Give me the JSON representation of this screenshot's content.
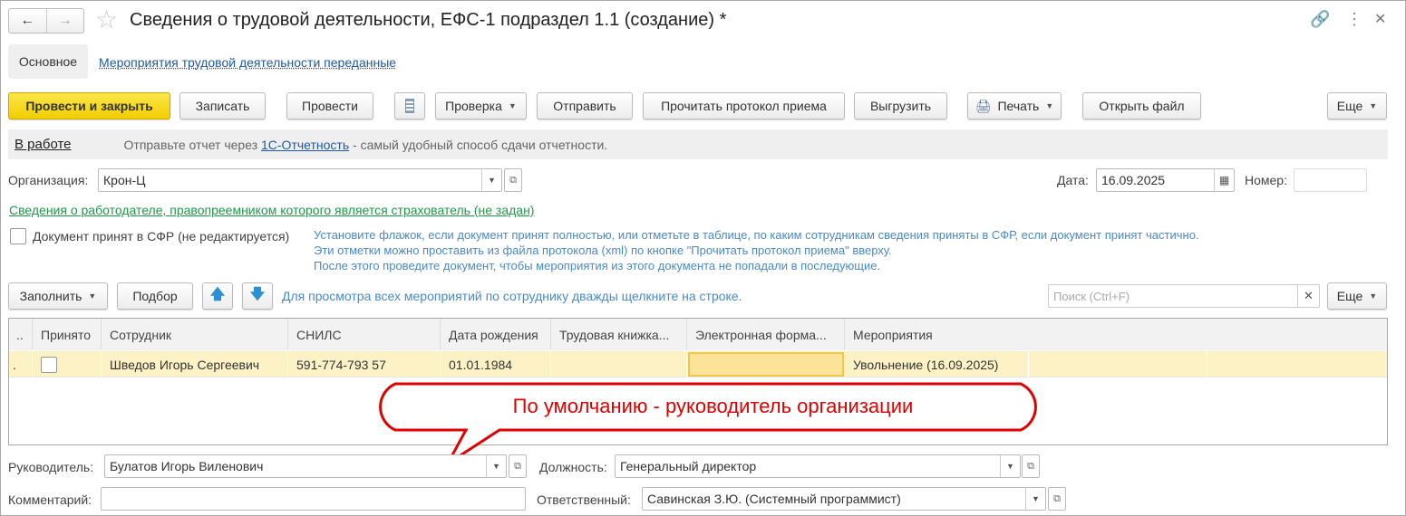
{
  "title": "Сведения о трудовой деятельности, ЕФС-1 подраздел 1.1 (создание) *",
  "tabs": [
    "Основное",
    "Мероприятия трудовой деятельности переданные"
  ],
  "toolbar": {
    "post_close": "Провести и закрыть",
    "save": "Записать",
    "post": "Провести",
    "check": "Проверка",
    "send": "Отправить",
    "read_protocol": "Прочитать протокол приема",
    "export": "Выгрузить",
    "print": "Печать",
    "open_file": "Открыть файл",
    "more": "Еще"
  },
  "status": {
    "state": "В работе",
    "text_before": "Отправьте отчет через ",
    "link": "1С-Отчетность",
    "text_after": " - самый удобный способ сдачи отчетности."
  },
  "org": {
    "label": "Организация:",
    "value": "Крон-Ц"
  },
  "date": {
    "label": "Дата:",
    "value": "16.09.2025"
  },
  "number": {
    "label": "Номер:",
    "value": ""
  },
  "employer_link": "Сведения о работодателе, правопреемником которого является страхователь (не задан)",
  "accepted": {
    "label": "Документ принят в СФР (не редактируется)",
    "checked": false
  },
  "hint": [
    "Установите флажок, если документ принят полностью, или отметьте в таблице, по каким сотрудникам сведения приняты в СФР, если документ принят частично.",
    "Эти отметки можно проставить из файла протокола (xml) по кнопке \"Прочитать протокол приема\" вверху.",
    "После этого проведите документ, чтобы мероприятия из этого документа не попадали в последующие."
  ],
  "table_toolbar": {
    "fill": "Заполнить",
    "select": "Подбор",
    "hint": "Для просмотра всех мероприятий по сотруднику дважды щелкните на строке.",
    "search_placeholder": "Поиск (Ctrl+F)",
    "more": "Еще"
  },
  "columns": [
    "..",
    "Принято",
    "Сотрудник",
    "СНИЛС",
    "Дата рождения",
    "Трудовая книжка...",
    "Электронная форма...",
    "Мероприятия"
  ],
  "rows": [
    {
      "marker": ".",
      "accepted": false,
      "employee": "Шведов Игорь Сергеевич",
      "snils": "591-774-793 57",
      "birth": "01.01.1984",
      "book": "",
      "eform": "",
      "events": "Увольнение (16.09.2025)"
    }
  ],
  "callout": "По умолчанию - руководитель организации",
  "head": {
    "label": "Руководитель:",
    "value": "Булатов Игорь Виленович"
  },
  "position": {
    "label": "Должность:",
    "value": "Генеральный директор"
  },
  "comment": {
    "label": "Комментарий:",
    "value": ""
  },
  "responsible": {
    "label": "Ответственный:",
    "value": "Савинская З.Ю. (Системный программист)"
  }
}
